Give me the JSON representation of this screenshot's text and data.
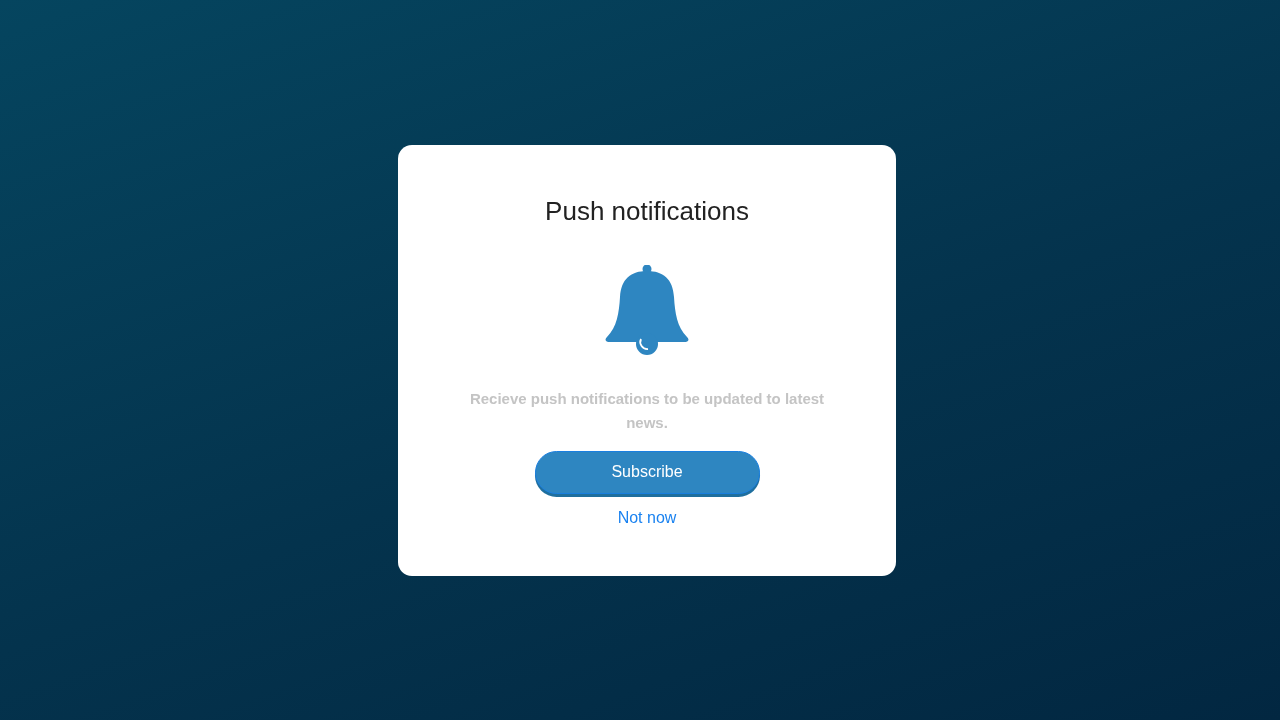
{
  "dialog": {
    "title": "Push notifications",
    "message": "Recieve push notifications to be updated to latest news.",
    "primary_button": "Subscribe",
    "secondary_link": "Not now"
  }
}
